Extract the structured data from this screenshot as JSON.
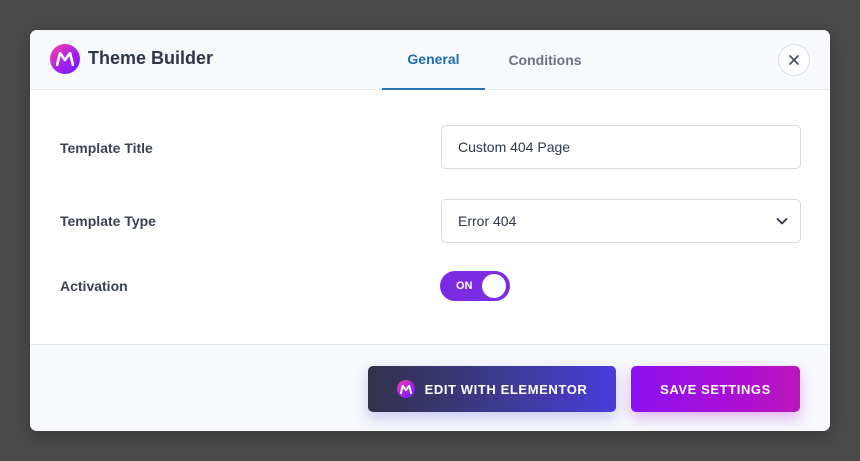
{
  "modal": {
    "title": "Theme Builder",
    "close_icon": "close-icon",
    "logo_icon": "brand-logo-icon"
  },
  "tabs": [
    {
      "label": "General",
      "active": true
    },
    {
      "label": "Conditions",
      "active": false
    }
  ],
  "form": {
    "template_title": {
      "label": "Template Title",
      "value": "Custom 404 Page"
    },
    "template_type": {
      "label": "Template Type",
      "value": "Error 404"
    },
    "activation": {
      "label": "Activation",
      "state": "ON"
    }
  },
  "footer": {
    "edit_label": "EDIT WITH ELEMENTOR",
    "save_label": "SAVE SETTINGS"
  },
  "colors": {
    "accent_tab": "#2a72b3",
    "toggle_on": "#7b2ce3",
    "save_button": "#8b10f0",
    "edit_button": "#4a3bdc"
  }
}
